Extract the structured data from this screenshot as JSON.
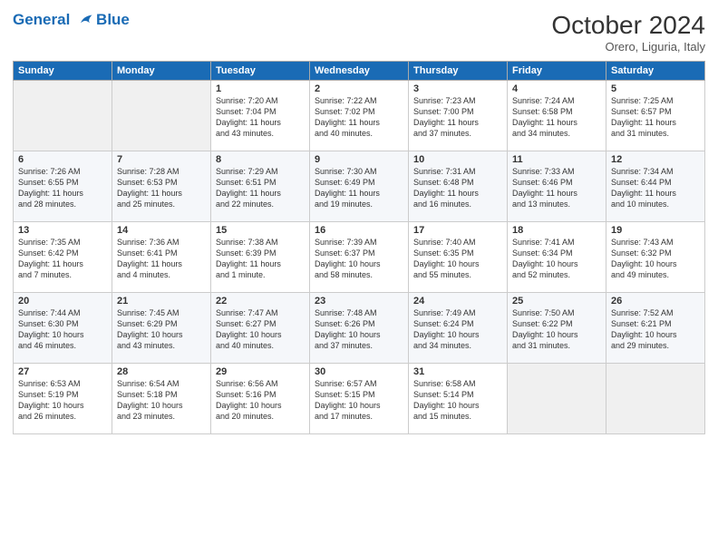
{
  "header": {
    "logo_line1": "General",
    "logo_line2": "Blue",
    "month_title": "October 2024",
    "location": "Orero, Liguria, Italy"
  },
  "weekdays": [
    "Sunday",
    "Monday",
    "Tuesday",
    "Wednesday",
    "Thursday",
    "Friday",
    "Saturday"
  ],
  "rows": [
    [
      {
        "day": "",
        "text": ""
      },
      {
        "day": "",
        "text": ""
      },
      {
        "day": "1",
        "text": "Sunrise: 7:20 AM\nSunset: 7:04 PM\nDaylight: 11 hours\nand 43 minutes."
      },
      {
        "day": "2",
        "text": "Sunrise: 7:22 AM\nSunset: 7:02 PM\nDaylight: 11 hours\nand 40 minutes."
      },
      {
        "day": "3",
        "text": "Sunrise: 7:23 AM\nSunset: 7:00 PM\nDaylight: 11 hours\nand 37 minutes."
      },
      {
        "day": "4",
        "text": "Sunrise: 7:24 AM\nSunset: 6:58 PM\nDaylight: 11 hours\nand 34 minutes."
      },
      {
        "day": "5",
        "text": "Sunrise: 7:25 AM\nSunset: 6:57 PM\nDaylight: 11 hours\nand 31 minutes."
      }
    ],
    [
      {
        "day": "6",
        "text": "Sunrise: 7:26 AM\nSunset: 6:55 PM\nDaylight: 11 hours\nand 28 minutes."
      },
      {
        "day": "7",
        "text": "Sunrise: 7:28 AM\nSunset: 6:53 PM\nDaylight: 11 hours\nand 25 minutes."
      },
      {
        "day": "8",
        "text": "Sunrise: 7:29 AM\nSunset: 6:51 PM\nDaylight: 11 hours\nand 22 minutes."
      },
      {
        "day": "9",
        "text": "Sunrise: 7:30 AM\nSunset: 6:49 PM\nDaylight: 11 hours\nand 19 minutes."
      },
      {
        "day": "10",
        "text": "Sunrise: 7:31 AM\nSunset: 6:48 PM\nDaylight: 11 hours\nand 16 minutes."
      },
      {
        "day": "11",
        "text": "Sunrise: 7:33 AM\nSunset: 6:46 PM\nDaylight: 11 hours\nand 13 minutes."
      },
      {
        "day": "12",
        "text": "Sunrise: 7:34 AM\nSunset: 6:44 PM\nDaylight: 11 hours\nand 10 minutes."
      }
    ],
    [
      {
        "day": "13",
        "text": "Sunrise: 7:35 AM\nSunset: 6:42 PM\nDaylight: 11 hours\nand 7 minutes."
      },
      {
        "day": "14",
        "text": "Sunrise: 7:36 AM\nSunset: 6:41 PM\nDaylight: 11 hours\nand 4 minutes."
      },
      {
        "day": "15",
        "text": "Sunrise: 7:38 AM\nSunset: 6:39 PM\nDaylight: 11 hours\nand 1 minute."
      },
      {
        "day": "16",
        "text": "Sunrise: 7:39 AM\nSunset: 6:37 PM\nDaylight: 10 hours\nand 58 minutes."
      },
      {
        "day": "17",
        "text": "Sunrise: 7:40 AM\nSunset: 6:35 PM\nDaylight: 10 hours\nand 55 minutes."
      },
      {
        "day": "18",
        "text": "Sunrise: 7:41 AM\nSunset: 6:34 PM\nDaylight: 10 hours\nand 52 minutes."
      },
      {
        "day": "19",
        "text": "Sunrise: 7:43 AM\nSunset: 6:32 PM\nDaylight: 10 hours\nand 49 minutes."
      }
    ],
    [
      {
        "day": "20",
        "text": "Sunrise: 7:44 AM\nSunset: 6:30 PM\nDaylight: 10 hours\nand 46 minutes."
      },
      {
        "day": "21",
        "text": "Sunrise: 7:45 AM\nSunset: 6:29 PM\nDaylight: 10 hours\nand 43 minutes."
      },
      {
        "day": "22",
        "text": "Sunrise: 7:47 AM\nSunset: 6:27 PM\nDaylight: 10 hours\nand 40 minutes."
      },
      {
        "day": "23",
        "text": "Sunrise: 7:48 AM\nSunset: 6:26 PM\nDaylight: 10 hours\nand 37 minutes."
      },
      {
        "day": "24",
        "text": "Sunrise: 7:49 AM\nSunset: 6:24 PM\nDaylight: 10 hours\nand 34 minutes."
      },
      {
        "day": "25",
        "text": "Sunrise: 7:50 AM\nSunset: 6:22 PM\nDaylight: 10 hours\nand 31 minutes."
      },
      {
        "day": "26",
        "text": "Sunrise: 7:52 AM\nSunset: 6:21 PM\nDaylight: 10 hours\nand 29 minutes."
      }
    ],
    [
      {
        "day": "27",
        "text": "Sunrise: 6:53 AM\nSunset: 5:19 PM\nDaylight: 10 hours\nand 26 minutes."
      },
      {
        "day": "28",
        "text": "Sunrise: 6:54 AM\nSunset: 5:18 PM\nDaylight: 10 hours\nand 23 minutes."
      },
      {
        "day": "29",
        "text": "Sunrise: 6:56 AM\nSunset: 5:16 PM\nDaylight: 10 hours\nand 20 minutes."
      },
      {
        "day": "30",
        "text": "Sunrise: 6:57 AM\nSunset: 5:15 PM\nDaylight: 10 hours\nand 17 minutes."
      },
      {
        "day": "31",
        "text": "Sunrise: 6:58 AM\nSunset: 5:14 PM\nDaylight: 10 hours\nand 15 minutes."
      },
      {
        "day": "",
        "text": ""
      },
      {
        "day": "",
        "text": ""
      }
    ]
  ]
}
